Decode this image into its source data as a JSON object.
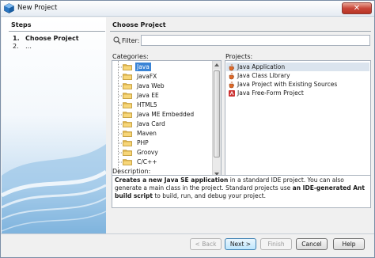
{
  "window": {
    "title": "New Project",
    "close_label": "✕"
  },
  "steps": {
    "header": "Steps",
    "items": [
      {
        "num": "1.",
        "label": "Choose Project"
      },
      {
        "num": "2.",
        "label": "…"
      }
    ]
  },
  "main": {
    "header": "Choose Project",
    "filter_label": "Filter:",
    "filter_value": "",
    "categories_label": "Categories:",
    "projects_label": "Projects:",
    "categories": [
      "Java",
      "JavaFX",
      "Java Web",
      "Java EE",
      "HTML5",
      "Java ME Embedded",
      "Java Card",
      "Maven",
      "PHP",
      "Groovy",
      "C/C++"
    ],
    "selected_category": "Java",
    "projects": [
      "Java Application",
      "Java Class Library",
      "Java Project with Existing Sources",
      "Java Free-Form Project"
    ],
    "selected_project": "Java Application",
    "description_label": "Description:",
    "description": {
      "bold1": "Creates a new Java SE application",
      "text1": " in a standard IDE project. You can also generate a main class in the project. Standard projects use ",
      "bold2": "an IDE-generated Ant build script",
      "text2": " to build, run, and debug your project."
    }
  },
  "buttons": {
    "back": "< Back",
    "next": "Next >",
    "finish": "Finish",
    "cancel": "Cancel",
    "help": "Help"
  },
  "colors": {
    "selection": "#3a84d6",
    "project_selection": "#dbe4ee",
    "gradient_blue": "#6fa8d6"
  }
}
